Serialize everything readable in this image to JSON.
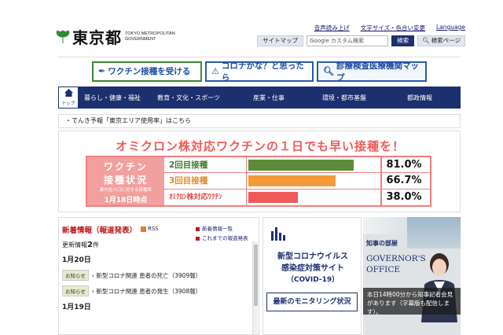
{
  "header": {
    "logo_text": "東京都",
    "logo_sub_line1": "TOKYO METROPOLITAN",
    "logo_sub_line2": "GOVERNMENT",
    "top_links": [
      "音声読み上げ",
      "文字サイズ・色合い変更",
      "Language"
    ],
    "sitemap_label": "サイトマップ",
    "search_placeholder": "Google カスタム検索",
    "search_button": "検索",
    "voice_page_label": "検索ページ"
  },
  "banners": [
    {
      "label": "ワクチン接種を受ける",
      "icon": "syringe-icon"
    },
    {
      "label": "コロナかな？と思ったら",
      "icon": "warning-icon"
    },
    {
      "label": "診療検査医療機関マップ",
      "icon": "search-icon"
    }
  ],
  "nav": {
    "home_label": "トップ",
    "items": [
      "暮らし・健康・福祉",
      "教育・文化・スポーツ",
      "産業・仕事",
      "環境・都市基盤",
      "都政情報"
    ]
  },
  "notice": "・でんき予報「東京エリア使用率」はこちら",
  "vaccine": {
    "headline": "オミクロン株対応ワクチンの１日でも早い接種を！",
    "side_line1": "ワクチン",
    "side_line2": "接種状況",
    "side_note": "都内全人口に対する接種率",
    "side_date": "1月18日時点",
    "rows": [
      {
        "label": "2回目接種",
        "value": 81.0,
        "display": "81.0%",
        "color": "#5d8b3a",
        "label_color": "#3f7d2c"
      },
      {
        "label": "3回目接種",
        "value": 66.7,
        "display": "66.7%",
        "color": "#f39a3a",
        "label_color": "#e38a2a"
      },
      {
        "label": "ｵﾐｸﾛﾝ株対応ﾜｸﾁﾝ",
        "value": 38.0,
        "display": "38.0%",
        "color": "#ee5a59",
        "label_color": "#e24848"
      }
    ]
  },
  "news": {
    "title": "新着情報（報道発表）",
    "rss": "RSS",
    "links": [
      "新着情報一覧",
      "これまでの報道発表"
    ],
    "count_prefix": "更新情報",
    "count_value": "2",
    "count_suffix": "件",
    "dates": [
      "1月20日",
      "1月19日"
    ],
    "items": [
      {
        "badge": "お知らせ",
        "text": "› 新型コロナ関連 患者の死亡（3909報）"
      },
      {
        "badge": "お知らせ",
        "text": "› 新型コロナ関連 患者の発生（3908報）"
      }
    ]
  },
  "corona": {
    "line1": "新型コロナウイルス",
    "line2": "感染症対策サイト",
    "line3": "（COVID-19）",
    "monitor": "最新のモニタリング状況"
  },
  "governor": {
    "tag": "知事の部屋",
    "title_line1": "GOVERNOR'S",
    "title_line2": "OFFICE",
    "caption": "本日14時00分から知事記者会見があります（字幕版も配信します）。"
  }
}
